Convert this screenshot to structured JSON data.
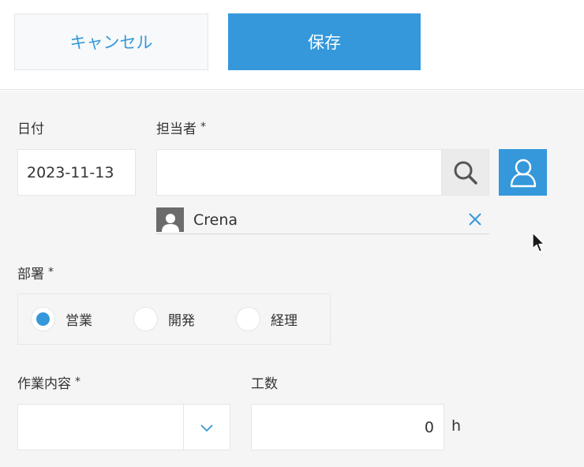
{
  "toolbar": {
    "cancel_label": "キャンセル",
    "save_label": "保存"
  },
  "form": {
    "date": {
      "label": "日付",
      "value": "2023-11-13"
    },
    "assignee": {
      "label": "担当者",
      "required_mark": "*",
      "input_value": "",
      "selected_user": "Crena"
    },
    "department": {
      "label": "部署",
      "required_mark": "*",
      "options": [
        "営業",
        "開発",
        "経理"
      ],
      "selected_index": 0
    },
    "work_content": {
      "label": "作業内容",
      "required_mark": "*",
      "value": ""
    },
    "man_hours": {
      "label": "工数",
      "value": "0",
      "unit": "h"
    }
  },
  "colors": {
    "accent": "#3498db",
    "form_background": "#f5f5f5",
    "border": "#e3e7e8"
  },
  "icons": {
    "search": "search-icon",
    "user_picker": "user-icon",
    "chip_avatar": "user-avatar-icon",
    "remove": "close-icon",
    "dropdown": "chevron-down-icon",
    "pointer": "mouse-cursor-icon"
  }
}
